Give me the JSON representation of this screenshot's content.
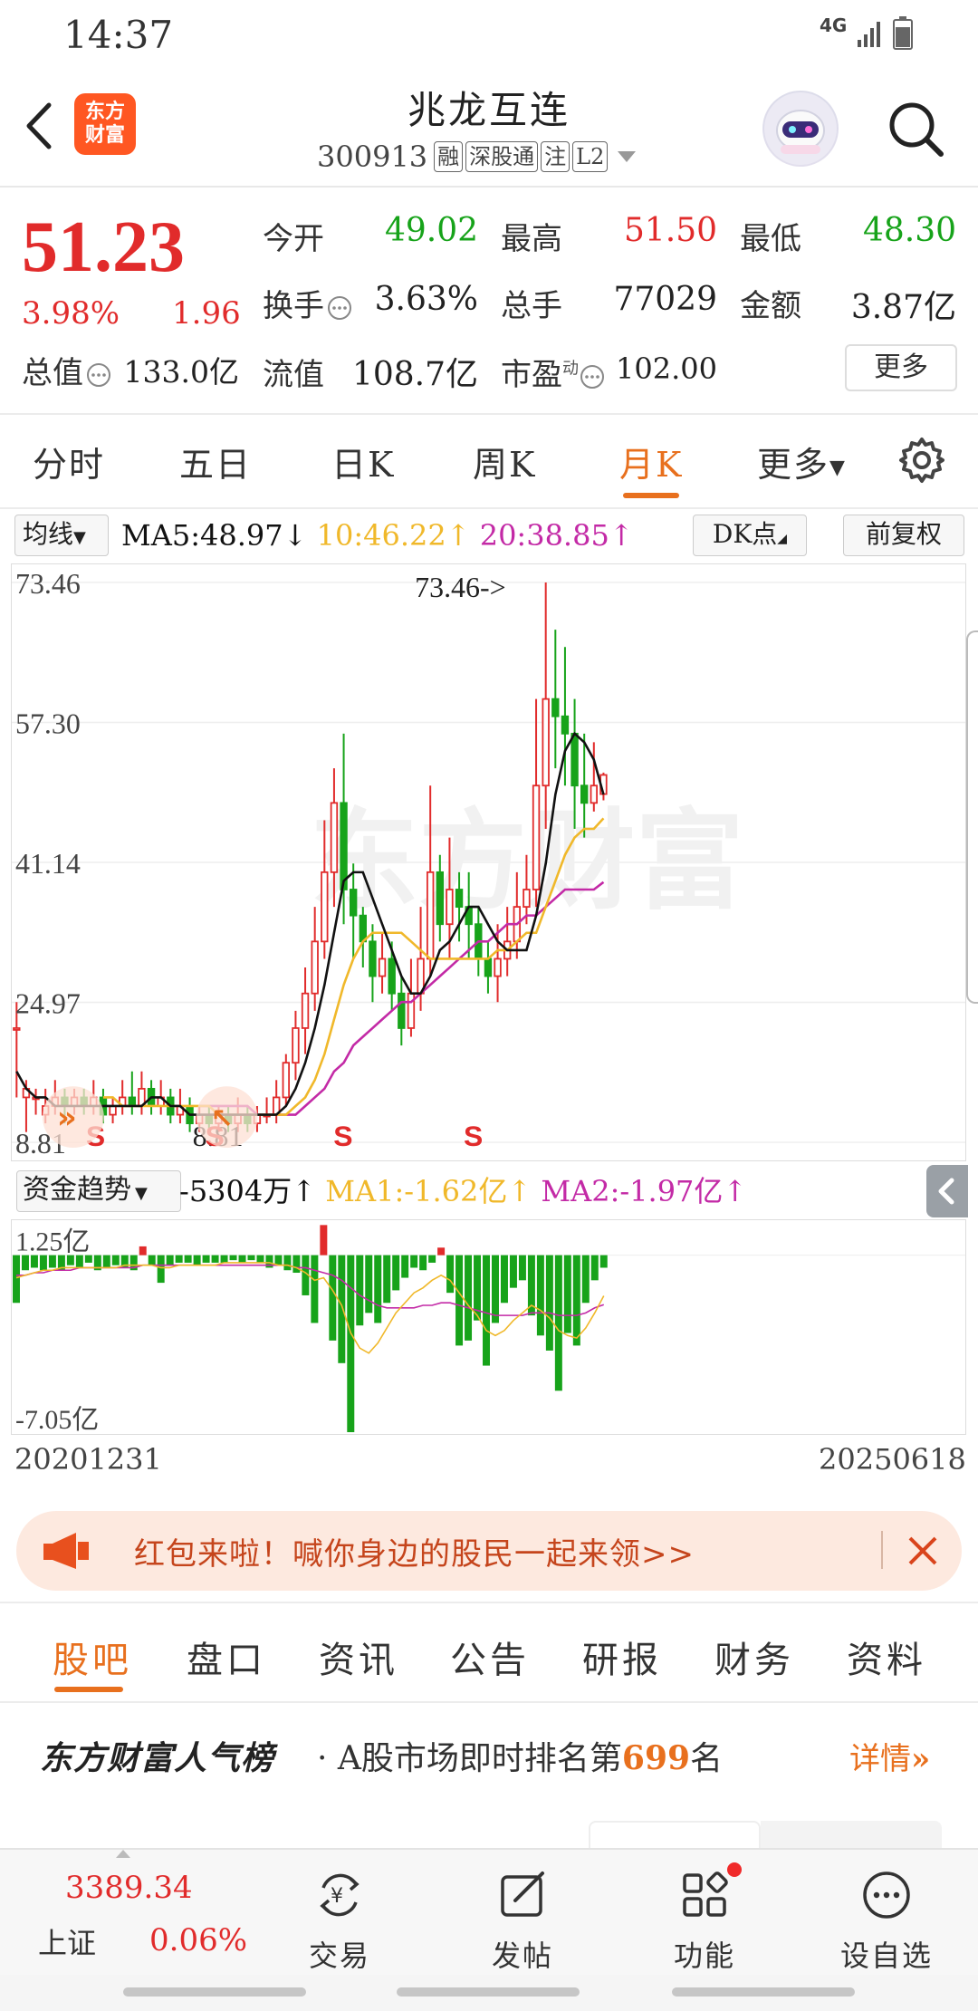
{
  "status_bar": {
    "time": "14:37",
    "network": "4G"
  },
  "header": {
    "logo_text_top": "东方",
    "logo_text_bottom": "财富",
    "stock_name": "兆龙互连",
    "stock_code": "300913",
    "tags": [
      "融",
      "深股通",
      "注",
      "L2"
    ]
  },
  "quote": {
    "price": "51.23",
    "change_pct": "3.98%",
    "change": "1.96",
    "open_label": "今开",
    "open": "49.02",
    "high_label": "最高",
    "high": "51.50",
    "low_label": "最低",
    "low": "48.30",
    "turnover_label": "换手",
    "turnover": "3.63%",
    "volume_label": "总手",
    "volume": "77029",
    "amount_label": "金额",
    "amount": "3.87亿",
    "mktcap_label": "总值",
    "mktcap": "133.0亿",
    "float_label": "流值",
    "float_cap": "108.7亿",
    "pe_label": "市盈",
    "pe_sup": "动",
    "pe": "102.00",
    "more_label": "更多"
  },
  "period_tabs": [
    "分时",
    "五日",
    "日K",
    "周K",
    "月K",
    "更多"
  ],
  "ma_row": {
    "select": "均线",
    "ma5": "MA5:48.97↓",
    "ma10": "10:46.22↑",
    "ma20": "20:38.85↑",
    "dk": "DK点",
    "fq": "前复权",
    "colors": {
      "ma5": "#111111",
      "ma10": "#f0b82a",
      "ma20": "#c32aa6"
    }
  },
  "chart_data": [
    {
      "type": "candlestick",
      "period": "month",
      "y_ticks": [
        "73.46",
        "57.30",
        "41.14",
        "24.97",
        "8.81"
      ],
      "ylim": [
        8.81,
        73.46
      ],
      "max_annotation": "73.46->",
      "min_annotation": "8.81",
      "signals": [
        "S",
        "S",
        "S",
        "S"
      ],
      "watermark": "东方财富",
      "up_color": "#e12b2b",
      "down_color": "#17a31a",
      "candles": [
        [
          22,
          22,
          14,
          25
        ],
        [
          14,
          15,
          10,
          16
        ],
        [
          14,
          14,
          12,
          15
        ],
        [
          12,
          13,
          11,
          15
        ],
        [
          13,
          14,
          12,
          16
        ],
        [
          14,
          13,
          11,
          15
        ],
        [
          13,
          14,
          12,
          15
        ],
        [
          14,
          13,
          12,
          15
        ],
        [
          13,
          14,
          12,
          16
        ],
        [
          14,
          12,
          11,
          15
        ],
        [
          12,
          13,
          11,
          14
        ],
        [
          13,
          14,
          12,
          16
        ],
        [
          14,
          13,
          12,
          17
        ],
        [
          13,
          15,
          12,
          17
        ],
        [
          15,
          13,
          12,
          16
        ],
        [
          13,
          14,
          12,
          16
        ],
        [
          14,
          12,
          11,
          15
        ],
        [
          12,
          13,
          11,
          15
        ],
        [
          13,
          11,
          10,
          14
        ],
        [
          11,
          12,
          10,
          13
        ],
        [
          12,
          11,
          10,
          13
        ],
        [
          11,
          12,
          10,
          13
        ],
        [
          12,
          11,
          10,
          13
        ],
        [
          11,
          12,
          10,
          14
        ],
        [
          12,
          11,
          10,
          13
        ],
        [
          11,
          12,
          10,
          13
        ],
        [
          12,
          12,
          11,
          14
        ],
        [
          12,
          14,
          11,
          16
        ],
        [
          14,
          18,
          13,
          19
        ],
        [
          18,
          22,
          16,
          24
        ],
        [
          22,
          26,
          19,
          29
        ],
        [
          26,
          32,
          24,
          36
        ],
        [
          32,
          40,
          30,
          46
        ],
        [
          40,
          48,
          36,
          52
        ],
        [
          48,
          38,
          34,
          56
        ],
        [
          38,
          35,
          30,
          41
        ],
        [
          35,
          32,
          29,
          36
        ],
        [
          32,
          28,
          25,
          34
        ],
        [
          28,
          30,
          26,
          33
        ],
        [
          30,
          26,
          24,
          32
        ],
        [
          26,
          22,
          20,
          28
        ],
        [
          22,
          26,
          21,
          30
        ],
        [
          26,
          30,
          24,
          36
        ],
        [
          30,
          40,
          28,
          50
        ],
        [
          40,
          34,
          32,
          42
        ],
        [
          34,
          38,
          30,
          44
        ],
        [
          38,
          36,
          32,
          40
        ],
        [
          36,
          34,
          30,
          40
        ],
        [
          34,
          30,
          28,
          36
        ],
        [
          30,
          28,
          26,
          32
        ],
        [
          28,
          30,
          25,
          34
        ],
        [
          30,
          32,
          28,
          36
        ],
        [
          32,
          36,
          30,
          40
        ],
        [
          36,
          38,
          34,
          42
        ],
        [
          38,
          50,
          36,
          60
        ],
        [
          50,
          60,
          45,
          73.46
        ],
        [
          60,
          58,
          52,
          68
        ],
        [
          58,
          56,
          50,
          66
        ],
        [
          56,
          50,
          45,
          60
        ],
        [
          50,
          48,
          44,
          56
        ],
        [
          48,
          50,
          47,
          55
        ],
        [
          49.02,
          51.23,
          48.3,
          51.5
        ]
      ],
      "ma5": [
        17,
        15,
        14,
        14,
        13,
        13,
        13,
        13,
        13,
        13,
        13,
        13,
        13,
        13,
        14,
        14,
        13,
        13,
        12,
        12,
        12,
        12,
        12,
        12,
        12,
        12,
        12,
        12,
        13,
        15,
        18,
        22,
        27,
        33,
        39,
        40,
        40,
        37,
        34,
        31,
        28,
        26,
        26,
        28,
        31,
        32,
        34,
        36,
        36,
        34,
        32,
        31,
        31,
        31,
        35,
        41,
        49,
        54,
        56,
        55,
        53,
        48.97
      ],
      "ma10": [
        null,
        null,
        null,
        null,
        null,
        null,
        null,
        null,
        null,
        14,
        14,
        13,
        13,
        13,
        13,
        13,
        13,
        13,
        13,
        13,
        13,
        12,
        12,
        12,
        12,
        12,
        12,
        12,
        12,
        13,
        14,
        16,
        19,
        23,
        27,
        30,
        32,
        33,
        33,
        33,
        33,
        32,
        31,
        30,
        30,
        30,
        30,
        30,
        30,
        30,
        31,
        31,
        32,
        33,
        33,
        36,
        39,
        42,
        44,
        45,
        45,
        46.22
      ],
      "ma20": [
        null,
        null,
        null,
        null,
        null,
        null,
        null,
        null,
        null,
        null,
        null,
        null,
        null,
        null,
        null,
        null,
        null,
        null,
        null,
        13,
        13,
        13,
        13,
        13,
        13,
        12,
        12,
        12,
        12,
        12,
        13,
        14,
        15,
        17,
        18,
        20,
        21,
        22,
        23,
        24,
        25,
        25,
        26,
        27,
        28,
        29,
        30,
        31,
        32,
        32,
        33,
        34,
        34,
        35,
        35,
        36,
        37,
        38,
        38,
        38,
        38,
        38.85
      ]
    },
    {
      "type": "bar",
      "title": "资金趋势",
      "y_ticks": [
        "1.25亿",
        "-7.05亿"
      ],
      "ylim": [
        -7.05,
        1.25
      ],
      "values": [
        -1.9,
        -0.6,
        -0.5,
        -0.6,
        -0.5,
        -0.6,
        -0.4,
        -0.5,
        -0.3,
        -0.6,
        -0.5,
        -0.4,
        -0.5,
        -0.6,
        0.35,
        -0.4,
        -1.1,
        -0.4,
        -0.3,
        -0.3,
        -0.4,
        -0.3,
        -0.3,
        -0.3,
        -0.2,
        -0.3,
        -0.2,
        -0.3,
        -0.5,
        -0.4,
        -0.6,
        -0.7,
        -1.6,
        -2.7,
        1.2,
        -3.4,
        -4.3,
        -7.05,
        -2.8,
        -2.3,
        -2.7,
        -1.9,
        -1.4,
        -0.9,
        -0.5,
        -0.6,
        -0.3,
        0.3,
        -1.5,
        -3.6,
        -3.4,
        -2.6,
        -4.4,
        -2.7,
        -1.9,
        -1.3,
        -1.0,
        -2.4,
        -3.2,
        -3.8,
        -5.4,
        -3.1,
        -3.6,
        -1.9,
        -1.0,
        -0.5
      ],
      "ma1": [
        -0.9,
        -0.8,
        -0.7,
        -0.6,
        -0.6,
        -0.5,
        -0.5,
        -0.5,
        -0.5,
        -0.5,
        -0.5,
        -0.5,
        -0.4,
        -0.4,
        -0.4,
        -0.4,
        -0.5,
        -0.5,
        -0.4,
        -0.4,
        -0.4,
        -0.4,
        -0.4,
        -0.3,
        -0.3,
        -0.3,
        -0.3,
        -0.3,
        -0.3,
        -0.4,
        -0.4,
        -0.5,
        -0.7,
        -1.0,
        -0.9,
        -1.4,
        -2.0,
        -3.1,
        -3.7,
        -3.9,
        -3.5,
        -2.9,
        -2.3,
        -1.9,
        -1.5,
        -1.3,
        -1.0,
        -0.8,
        -1.0,
        -1.5,
        -2.0,
        -2.4,
        -3.0,
        -3.2,
        -3.0,
        -2.6,
        -2.3,
        -2.0,
        -2.2,
        -2.5,
        -3.0,
        -3.2,
        -3.3,
        -2.9,
        -2.3,
        -1.62
      ],
      "ma2": [
        -0.8,
        -0.8,
        -0.7,
        -0.7,
        -0.6,
        -0.6,
        -0.6,
        -0.5,
        -0.5,
        -0.5,
        -0.5,
        -0.5,
        -0.5,
        -0.5,
        -0.4,
        -0.4,
        -0.4,
        -0.4,
        -0.4,
        -0.4,
        -0.4,
        -0.4,
        -0.4,
        -0.4,
        -0.4,
        -0.4,
        -0.4,
        -0.4,
        -0.4,
        -0.4,
        -0.4,
        -0.5,
        -0.5,
        -0.6,
        -0.7,
        -0.8,
        -1.0,
        -1.3,
        -1.6,
        -1.8,
        -2.0,
        -2.1,
        -2.1,
        -2.1,
        -2.1,
        -2.0,
        -2.0,
        -1.9,
        -1.9,
        -2.0,
        -2.1,
        -2.2,
        -2.3,
        -2.4,
        -2.4,
        -2.4,
        -2.4,
        -2.3,
        -2.3,
        -2.3,
        -2.4,
        -2.4,
        -2.4,
        -2.3,
        -2.1,
        -1.97
      ]
    }
  ],
  "indicator_row": {
    "select": "资金趋势",
    "value": "-5304万↑",
    "ma1": "MA1:-1.62亿↑",
    "ma2": "MA2:-1.97亿↑",
    "colors": {
      "ma1": "#f0b82a",
      "ma2": "#c32aa6"
    }
  },
  "date_range": {
    "start": "20201231",
    "end": "20250618"
  },
  "promo": {
    "text": "红包来啦！喊你身边的股民一起来领>>"
  },
  "section_tabs": [
    "股吧",
    "盘口",
    "资讯",
    "公告",
    "研报",
    "财务",
    "资料"
  ],
  "ranking": {
    "brand": "东方财富人气榜",
    "prefix": "· A股市场即时排名第",
    "rank": "699",
    "suffix": "名",
    "detail": "详情"
  },
  "bottom_nav": {
    "index_value": "3389.34",
    "index_name": "上证",
    "index_pct": "0.06%",
    "items": [
      "交易",
      "发帖",
      "功能",
      "设自选"
    ]
  },
  "icons": [
    "back-arrow-icon",
    "search-icon",
    "settings-gear-icon",
    "megaphone-icon",
    "close-icon",
    "yuan-exchange-icon",
    "edit-post-icon",
    "grid-function-icon",
    "more-dots-icon",
    "collapse-arrow-icon"
  ]
}
